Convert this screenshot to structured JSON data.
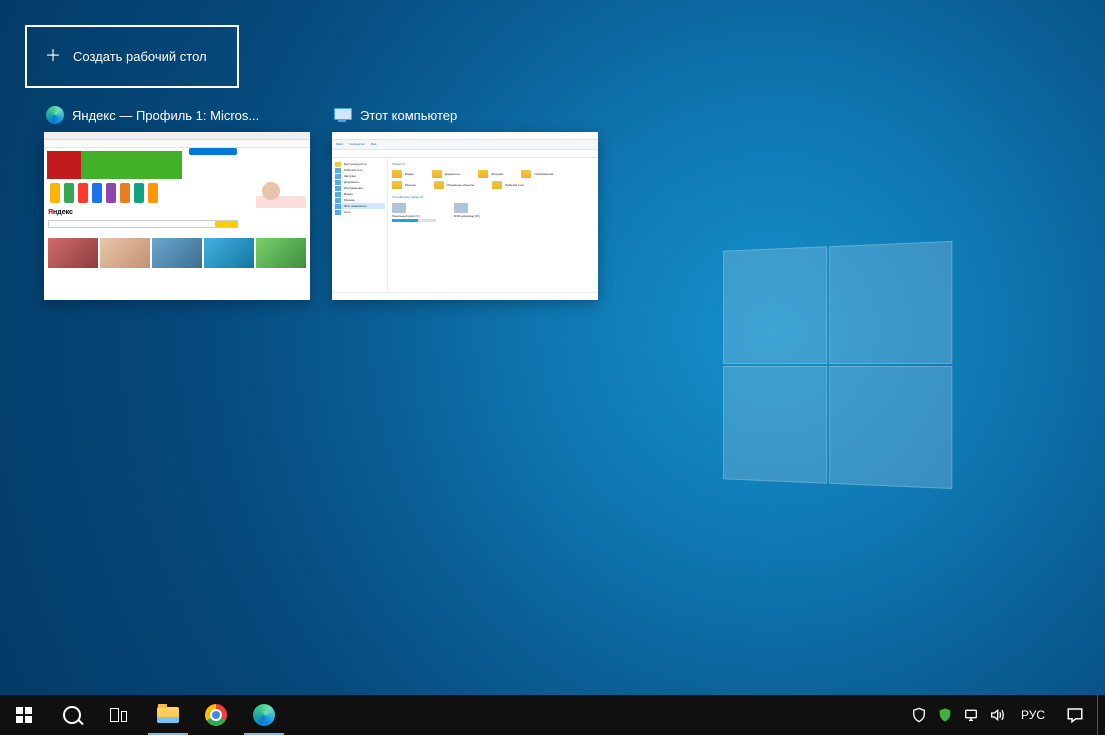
{
  "desktopBar": {
    "newDesktopLabel": "Создать рабочий стол"
  },
  "taskViewWindows": [
    {
      "id": "win-edge",
      "title": "Яндекс — Профиль 1: Micros...",
      "icon": "edge"
    },
    {
      "id": "win-explorer",
      "title": "Этот компьютер",
      "icon": "pc"
    }
  ],
  "miniBrowser": {
    "logoRed": "Я",
    "logoBlack": "ндекс"
  },
  "miniExplorer": {
    "ribbonTabs": [
      "Файл",
      "Компьютер",
      "Вид"
    ],
    "side": [
      "Быстрый доступ",
      "Рабочий стол",
      "Загрузки",
      "Документы",
      "Изображения",
      "Видео",
      "Музыка",
      "Этот компьютер",
      "Сеть"
    ],
    "sectionFolders": "Папки (7)",
    "folders": [
      "Видео",
      "Документы",
      "Загрузки",
      "Изображения",
      "Музыка",
      "Объемные объекты",
      "Рабочий стол"
    ],
    "sectionDrives": "Устройства и диски (2)",
    "drives": [
      "Локальный диск (C:)",
      "DVD-дисковод (D:)"
    ]
  },
  "taskbar": {
    "language": "РУС"
  }
}
